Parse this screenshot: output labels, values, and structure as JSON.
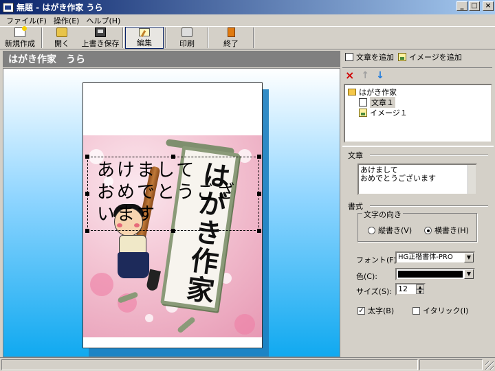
{
  "window": {
    "title": "無題 - はがき作家 うら",
    "min_label": "_",
    "max_label": "□",
    "close_label": "×"
  },
  "menu": {
    "items": [
      "ファイル(F)",
      "操作(E)",
      "ヘルプ(H)"
    ]
  },
  "toolbar": {
    "new_label": "新規作成",
    "open_label": "開く",
    "save_label": "上書き保存",
    "edit_label": "編集",
    "print_label": "印刷",
    "exit_label": "終了"
  },
  "document": {
    "title": "はがき作家　うら"
  },
  "canvas": {
    "textbox_text": "あけまして\nおめでとうござ\nいます",
    "scroll_text": "はがき作家"
  },
  "panel": {
    "add_text_label": "文章を追加",
    "add_image_label": "イメージを追加",
    "delete_icon": "×",
    "up_icon": "↑",
    "down_icon": "↓",
    "tree": {
      "root": "はがき作家",
      "children": [
        "文章１",
        "イメージ１"
      ]
    },
    "text_section": "文章",
    "text_value": "あけまして\nおめでとうございます",
    "format_section": "書式",
    "direction_group": "文字の向き",
    "vertical_label": "縦書き(V)",
    "horizontal_label": "横書き(H)",
    "orientation": "horizontal",
    "font_label": "フォント(F):",
    "font_value": "HG正楷書体-PRO",
    "color_label": "色(C):",
    "color_value": "#000000",
    "size_label": "サイズ(S):",
    "size_value": "12",
    "bold_label": "太字(B)",
    "bold_checked": true,
    "italic_label": "イタリック(I)",
    "italic_checked": false
  }
}
